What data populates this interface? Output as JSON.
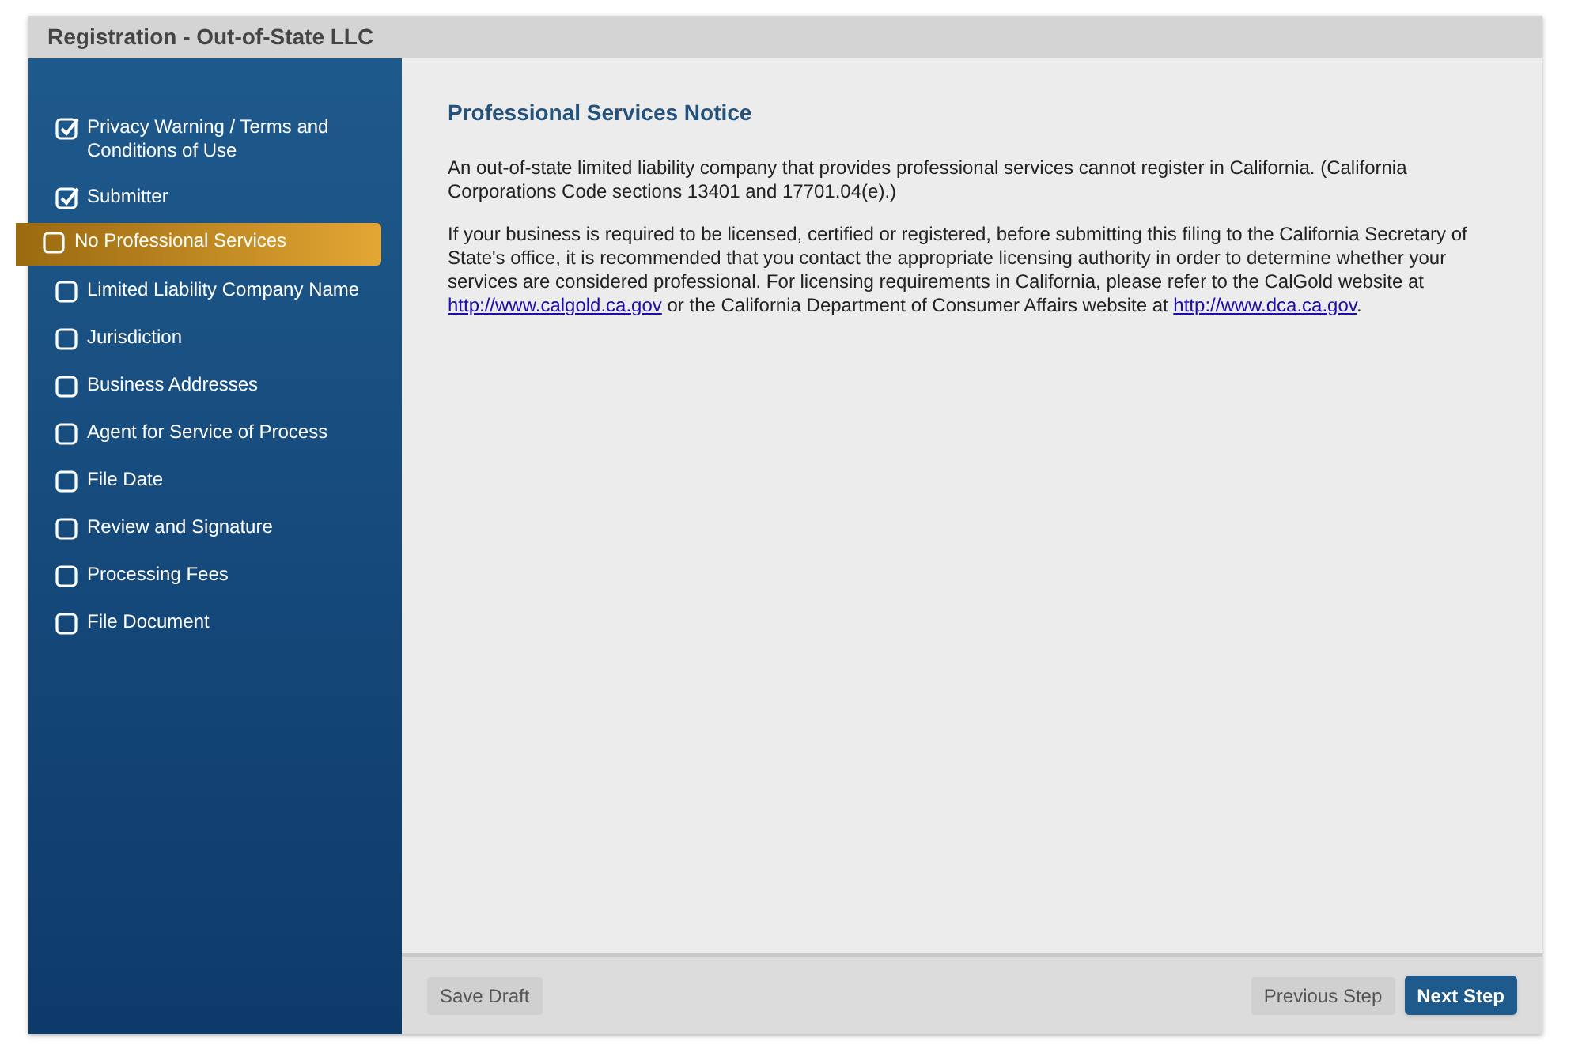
{
  "window": {
    "title": "Registration - Out-of-State LLC"
  },
  "steps": [
    {
      "label": "Privacy Warning / Terms and Conditions of Use",
      "checked": true,
      "selected": false
    },
    {
      "label": "Submitter",
      "checked": true,
      "selected": false
    },
    {
      "label": "No Professional Services",
      "checked": false,
      "selected": true
    },
    {
      "label": "Limited Liability Company Name",
      "checked": false,
      "selected": false
    },
    {
      "label": "Jurisdiction",
      "checked": false,
      "selected": false
    },
    {
      "label": "Business Addresses",
      "checked": false,
      "selected": false
    },
    {
      "label": "Agent for Service of Process",
      "checked": false,
      "selected": false
    },
    {
      "label": "File Date",
      "checked": false,
      "selected": false
    },
    {
      "label": "Review and Signature",
      "checked": false,
      "selected": false
    },
    {
      "label": "Processing Fees",
      "checked": false,
      "selected": false
    },
    {
      "label": "File Document",
      "checked": false,
      "selected": false
    }
  ],
  "content": {
    "heading": "Professional Services Notice",
    "paragraphs": [
      [
        {
          "kind": "text",
          "text": "An out-of-state limited liability company that provides professional services cannot register in California. (California Corporations Code sections 13401 and 17701.04(e).)"
        }
      ],
      [
        {
          "kind": "text",
          "text": "If your business is required to be licensed, certified or registered, before submitting this filing to the California Secretary of State's office, it is recommended that you contact the appropriate licensing authority in order to determine whether your services are considered professional. For licensing requirements in California, please refer to the CalGold website at "
        },
        {
          "kind": "link",
          "text": "http://www.calgold.ca.gov"
        },
        {
          "kind": "text",
          "text": " or the California Department of Consumer Affairs website at "
        },
        {
          "kind": "link",
          "text": "http://www.dca.ca.gov"
        },
        {
          "kind": "text",
          "text": "."
        }
      ]
    ]
  },
  "footer": {
    "save": "Save Draft",
    "previous": "Previous Step",
    "next": "Next Step"
  }
}
